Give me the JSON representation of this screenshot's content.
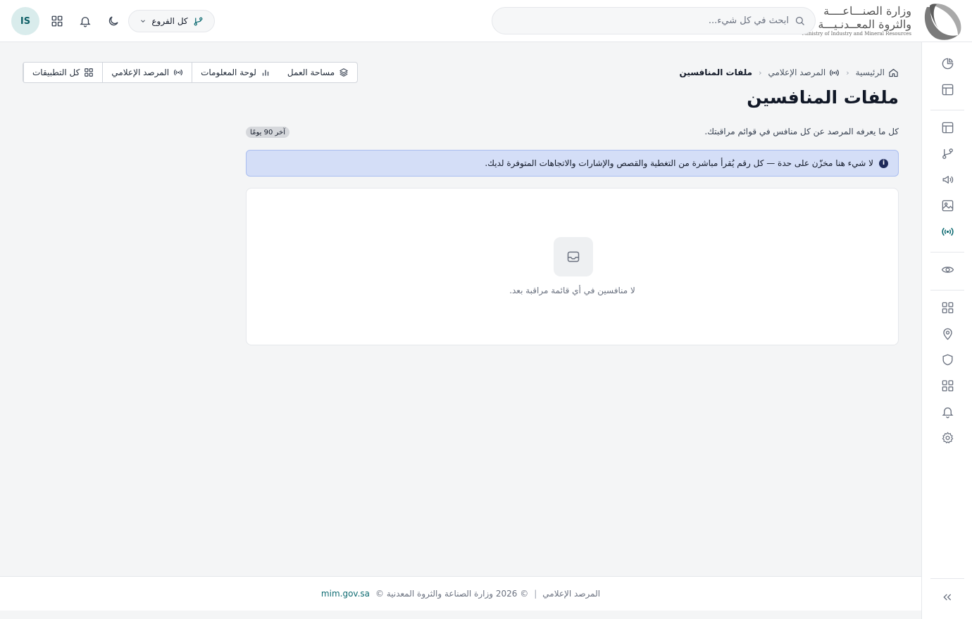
{
  "header": {
    "logo_line1": "وزارة الصنـــاعــــة",
    "logo_line2": "والثروة المعــدنـيـــة",
    "logo_english": "Ministry of Industry and Mineral Resources",
    "search_placeholder": "ابحث في كل شيء...",
    "branch_label": "كل الفروع",
    "avatar_initials": "IS"
  },
  "toolbar": {
    "all_apps": "كل التطبيقات",
    "media_monitor": "المرصد الإعلامي",
    "dashboard": "لوحة المعلومات",
    "workspace": "مساحة العمل"
  },
  "breadcrumb": {
    "home": "الرئيسية",
    "section": "المرصد الإعلامي",
    "current": "ملفات المنافسين"
  },
  "page": {
    "title": "ملفات المنافسين",
    "subtitle": "كل ما يعرفه المرصد عن كل منافس في قوائم مراقبتك.",
    "range_badge": "آخر 90 يومًا",
    "info_text": "لا شيء هنا مخزّن على حدة — كل رقم يُقرأ مباشرة من التغطية والقصص والإشارات والاتجاهات المتوفرة لديك.",
    "empty_text": "لا منافسين في أي قائمة مراقبة بعد."
  },
  "footer": {
    "app_name": "المرصد الإعلامي",
    "copyright": "© 2026 وزارة الصناعة والثروة المعدنية ©",
    "link": "mim.gov.sa"
  },
  "sidebar_icons": [
    "pie-chart-icon",
    "layout-icon",
    "layout-icon",
    "git-branch-icon",
    "megaphone-icon",
    "image-icon",
    "broadcast-icon",
    "eye-icon",
    "grid-icon",
    "map-pin-icon",
    "shield-icon",
    "grid-icon",
    "bell-icon",
    "settings-icon",
    "collapse-icon"
  ],
  "colors": {
    "accent": "#0e6b72",
    "info_bg": "#d4def7",
    "info_border": "#a9bdf0"
  }
}
